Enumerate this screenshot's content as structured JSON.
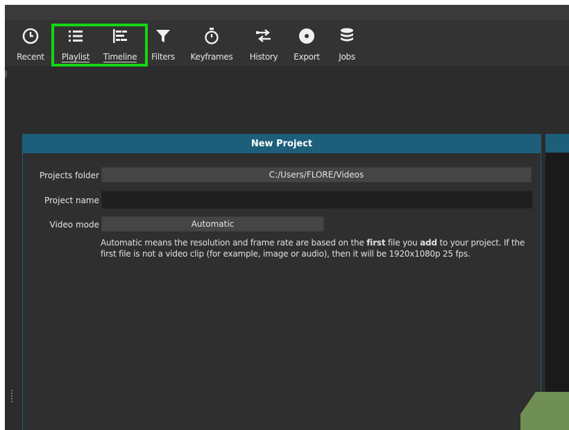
{
  "toolbar": {
    "items": [
      {
        "label": "Recent",
        "icon": "clock-icon"
      },
      {
        "label": "Playlist",
        "icon": "list-icon"
      },
      {
        "label": "Timeline",
        "icon": "timeline-icon"
      },
      {
        "label": "Filters",
        "icon": "filter-icon"
      },
      {
        "label": "Keyframes",
        "icon": "stopwatch-icon"
      },
      {
        "label": "History",
        "icon": "history-icon"
      },
      {
        "label": "Export",
        "icon": "disc-icon"
      },
      {
        "label": "Jobs",
        "icon": "database-icon"
      }
    ],
    "highlight_color": "#15d615"
  },
  "new_project": {
    "title": "New Project",
    "projects_folder_label": "Projects folder",
    "projects_folder_value": "C:/Users/FLORE/Videos",
    "project_name_label": "Project name",
    "project_name_value": "",
    "video_mode_label": "Video mode",
    "video_mode_value": "Automatic",
    "help_part1": "Automatic means the resolution and frame rate are based on the ",
    "help_bold1": "first",
    "help_part2": " file you ",
    "help_bold2": "add",
    "help_part3": " to your project. If the first file is not a video clip (for example, image or audio), then it will be 1920x1080p 25 fps."
  },
  "colors": {
    "header_blue": "#1d5f7a",
    "background": "#2c2c2c"
  }
}
